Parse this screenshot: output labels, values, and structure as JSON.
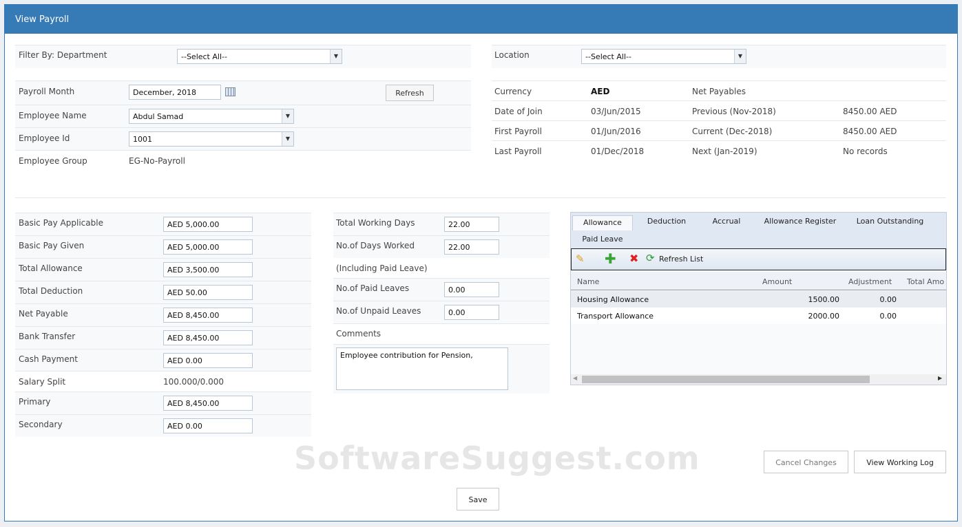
{
  "title": "View Payroll",
  "filter": {
    "department_label": "Filter By: Department",
    "department_value": "--Select All--",
    "location_label": "Location",
    "location_value": "--Select All--"
  },
  "employee": {
    "payroll_month_label": "Payroll Month",
    "payroll_month": "December, 2018",
    "refresh": "Refresh",
    "name_label": "Employee Name",
    "name": "Abdul Samad",
    "id_label": "Employee Id",
    "id": "1001",
    "group_label": "Employee Group",
    "group": "EG-No-Payroll"
  },
  "info": {
    "currency_label": "Currency",
    "currency": "AED",
    "net_payables": "Net Payables",
    "doj_label": "Date of Join",
    "doj": "03/Jun/2015",
    "first_label": "First Payroll",
    "first": "01/Jun/2016",
    "last_label": "Last Payroll",
    "last": "01/Dec/2018",
    "prev_label": "Previous (Nov-2018)",
    "prev": "8450.00 AED",
    "cur_label": "Current (Dec-2018)",
    "cur": "8450.00 AED",
    "next_label": "Next (Jan-2019)",
    "next": "No records"
  },
  "pay": [
    {
      "label": "Basic Pay Applicable",
      "value": "AED 5,000.00"
    },
    {
      "label": "Basic Pay Given",
      "value": "AED 5,000.00"
    },
    {
      "label": "Total Allowance",
      "value": "AED 3,500.00"
    },
    {
      "label": "Total Deduction",
      "value": "AED 50.00"
    },
    {
      "label": "Net Payable",
      "value": "AED 8,450.00"
    },
    {
      "label": "Bank Transfer",
      "value": "AED 8,450.00"
    },
    {
      "label": "Cash Payment",
      "value": "AED 0.00"
    }
  ],
  "salary_split_label": "Salary Split",
  "salary_split": "100.000/0.000",
  "primary_label": "Primary",
  "primary": "AED 8,450.00",
  "secondary_label": "Secondary",
  "secondary": "AED 0.00",
  "days": {
    "total_label": "Total Working Days",
    "total": "22.00",
    "worked_label": "No.of Days Worked",
    "worked": "22.00",
    "incl": "(Including Paid Leave)",
    "paid_label": "No.of Paid Leaves",
    "paid": "0.00",
    "unpaid_label": "No.of Unpaid Leaves",
    "unpaid": "0.00",
    "comments_label": "Comments",
    "comments": "Employee contribution for Pension,"
  },
  "tabs": [
    "Allowance",
    "Deduction",
    "Accrual",
    "Allowance Register",
    "Loan Outstanding",
    "Paid Leave"
  ],
  "toolbar": {
    "refresh_list": "Refresh List"
  },
  "grid": {
    "headers": [
      "Name",
      "Amount",
      "Adjustment",
      "Total Amo"
    ],
    "rows": [
      [
        "Housing Allowance",
        "1500.00",
        "0.00"
      ],
      [
        "Transport Allowance",
        "2000.00",
        "0.00"
      ]
    ]
  },
  "buttons": {
    "cancel": "Cancel Changes",
    "log": "View Working Log",
    "save": "Save"
  },
  "watermark": "SoftwareSuggest.com"
}
